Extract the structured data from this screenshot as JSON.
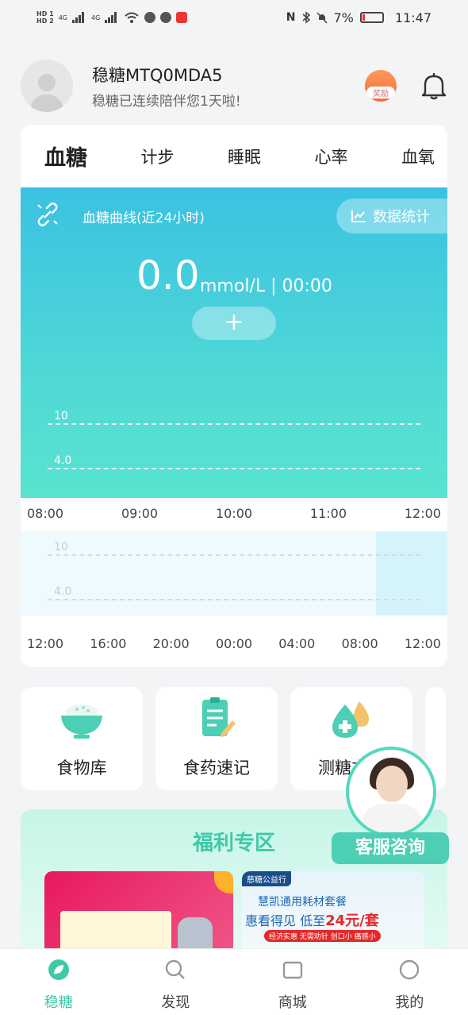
{
  "status_bar": {
    "hd1": "HD 1",
    "hd2": "HD 2",
    "net1": "4G",
    "net2": "4G",
    "battery": "7%",
    "time": "11:47"
  },
  "header": {
    "username": "稳糖MTQ0MDA5",
    "subtitle": "稳糖已连续陪伴您1天啦!",
    "reward_badge": "奖励"
  },
  "tabs": [
    {
      "label": "血糖",
      "active": true
    },
    {
      "label": "计步",
      "active": false
    },
    {
      "label": "睡眠",
      "active": false
    },
    {
      "label": "心率",
      "active": false
    },
    {
      "label": "血氧",
      "active": false
    }
  ],
  "chart_panel": {
    "title": "血糖曲线(近24小时)",
    "stats_button": "数据统计",
    "value": "0.0",
    "unit_time": "mmol/L | 00:00",
    "add_label": "+",
    "accent_top": "#3ac2e2",
    "accent_bottom": "#58e4cf"
  },
  "chart_data": [
    {
      "type": "line",
      "title": "血糖曲线(近24小时)",
      "x": [
        "08:00",
        "09:00",
        "10:00",
        "11:00",
        "12:00"
      ],
      "series": [],
      "reference_lines": [
        10,
        4.0
      ],
      "reference_labels": [
        "10",
        "4.0"
      ],
      "grid": false
    },
    {
      "type": "line",
      "x": [
        "12:00",
        "16:00",
        "20:00",
        "00:00",
        "04:00",
        "08:00",
        "12:00"
      ],
      "series": [],
      "reference_lines": [
        10,
        4.0
      ],
      "reference_labels": [
        "10",
        "4.0"
      ]
    }
  ],
  "tools": [
    {
      "label": "食物库",
      "icon": "rice-bowl-icon"
    },
    {
      "label": "食药速记",
      "icon": "notepad-icon"
    },
    {
      "label": "测糖方案",
      "icon": "blood-drop-icon"
    }
  ],
  "welfare": {
    "title": "福利专区",
    "banner2_tag": "慈糖公益行",
    "banner2_line1": "慧凯通用耗材套餐",
    "banner2_line2": "惠看得见 低至",
    "banner2_price": "24元/套",
    "banner2_line3": "经济实惠 无需劝针 创口小 痛感小"
  },
  "service": {
    "label": "客服咨询"
  },
  "bottom_nav": [
    {
      "label": "稳糖",
      "icon": "leaf-icon",
      "active": true
    },
    {
      "label": "发现",
      "icon": "search-icon",
      "active": false
    },
    {
      "label": "商城",
      "icon": "shop-icon",
      "active": false
    },
    {
      "label": "我的",
      "icon": "profile-icon",
      "active": false
    }
  ],
  "colors": {
    "brand": "#3fc9a8",
    "welfare_title": "#3fc9a8"
  }
}
